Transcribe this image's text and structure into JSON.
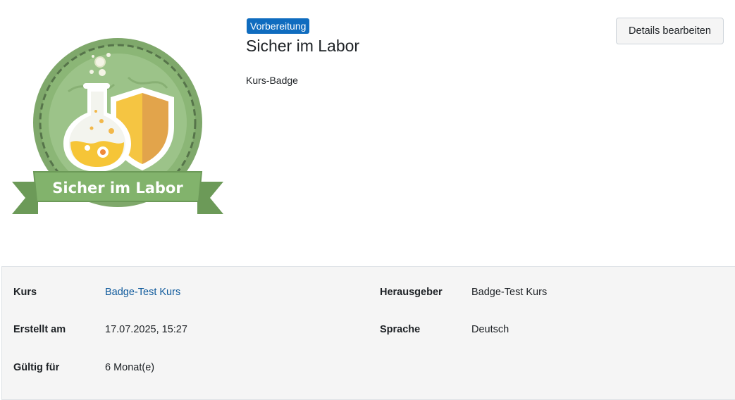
{
  "badge": {
    "status": "Vorbereitung",
    "title": "Sicher im Labor",
    "type_label": "Kurs-Badge",
    "image_text": "Sicher im Labor",
    "colors": {
      "badge_green": "#8bb676",
      "ribbon_green": "#82b36c",
      "shield_yellow": "#f5c542",
      "shield_orange": "#e2a44b",
      "status_blue": "#0f6cbf"
    }
  },
  "actions": {
    "edit_label": "Details bearbeiten"
  },
  "details": {
    "course_label": "Kurs",
    "course_value": "Badge-Test Kurs",
    "created_label": "Erstellt am",
    "created_value": "17.07.2025, 15:27",
    "valid_label": "Gültig für",
    "valid_value": "6 Monat(e)",
    "issuer_label": "Herausgeber",
    "issuer_value": "Badge-Test Kurs",
    "language_label": "Sprache",
    "language_value": "Deutsch"
  }
}
